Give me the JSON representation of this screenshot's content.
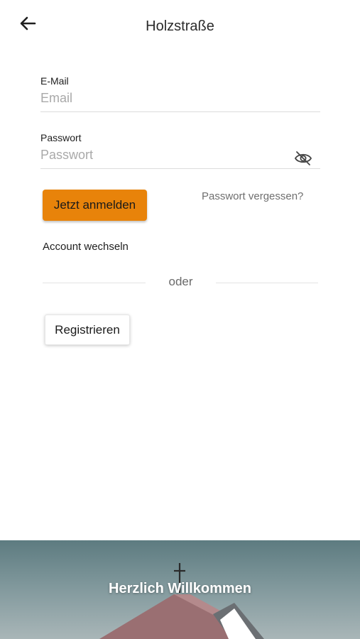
{
  "header": {
    "title": "Holzstraße",
    "back_icon": "arrow-left-icon"
  },
  "form": {
    "email": {
      "label": "E-Mail",
      "placeholder": "Email",
      "value": ""
    },
    "password": {
      "label": "Passwort",
      "placeholder": "Passwort",
      "value": "",
      "toggle_icon": "eye-slash-icon"
    },
    "login_label": "Jetzt anmelden",
    "forgot_label": "Passwort vergessen?",
    "switch_account_label": "Account wechseln",
    "divider_label": "oder",
    "register_label": "Registrieren"
  },
  "banner": {
    "title": "Herzlich Willkommen",
    "image_subject": "church-roof-with-cross"
  },
  "colors": {
    "accent": "#e8830a",
    "banner_sky": "#5d7b80",
    "roof": "#9a6f72"
  }
}
